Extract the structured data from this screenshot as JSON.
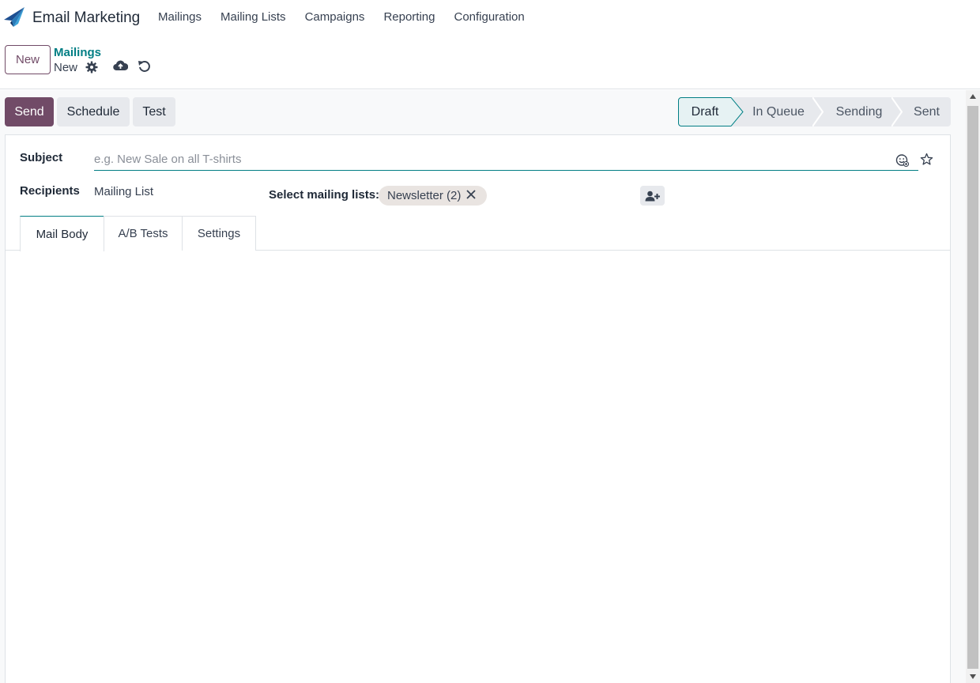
{
  "app": {
    "name": "Email Marketing",
    "logo_icon": "paper-plane-logo-icon",
    "brand_color": "#714b67",
    "accent_color": "#017e84"
  },
  "nav": {
    "items": [
      "Mailings",
      "Mailing Lists",
      "Campaigns",
      "Reporting",
      "Configuration"
    ]
  },
  "control_panel": {
    "new_label": "New",
    "breadcrumb": "Mailings",
    "record_name": "New",
    "icons": [
      "gear-icon",
      "cloud-upload-icon",
      "undo-icon"
    ]
  },
  "statusbar": {
    "send_label": "Send",
    "schedule_label": "Schedule",
    "test_label": "Test",
    "stages": [
      "Draft",
      "In Queue",
      "Sending",
      "Sent"
    ],
    "active_stage": "Draft"
  },
  "form": {
    "subject_label": "Subject",
    "subject_value": "",
    "subject_placeholder": "e.g. New Sale on all T-shirts",
    "recipients_label": "Recipients",
    "recipients_value": "Mailing List",
    "select_lists_label": "Select mailing lists:",
    "selected_lists": [
      "Newsletter (2)"
    ]
  },
  "tabs": {
    "items": [
      "Mail Body",
      "A/B Tests",
      "Settings"
    ],
    "active": "Mail Body"
  }
}
